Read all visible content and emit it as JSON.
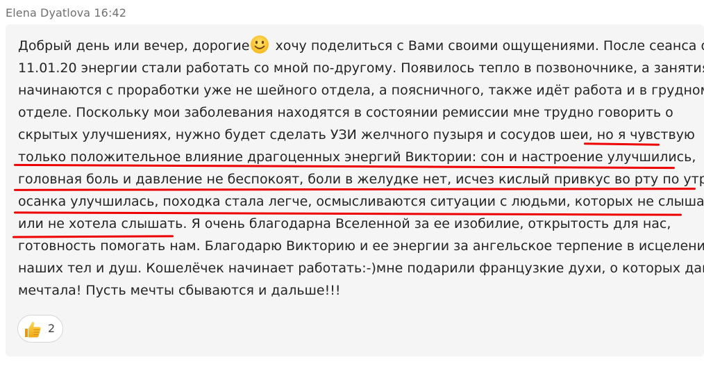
{
  "message": {
    "author": "Elena Dyatlova",
    "time": "16:42",
    "lines": [
      {
        "before": "Добрый день или вечер, дорогие",
        "after": " хочу поделиться с Вами своими ощущениями. После сеанса от"
      },
      {
        "text": "11.01.20 энергии стали работать со мной по-другому. Появилось тепло в позвоночнике, а занятия"
      },
      {
        "text": "начинаются с проработки уже не шейного отдела, а поясничного, также идёт работа и в грудном"
      },
      {
        "text": "отделе. Поскольку мои заболевания находятся в состоянии ремиссии мне трудно говорить о"
      },
      {
        "text": "скрытых улучшениях, нужно будет сделать УЗИ желчного пузыря и сосудов шеи, но я чувствую"
      },
      {
        "text": "только положительное влияние драгоценных энергий Виктории: сон и настроение улучшились,"
      },
      {
        "text": "головная боль и давление не беспокоят, боли в желудке нет, исчез кислый привкус во рту по утрам,"
      },
      {
        "text": "осанка улучшилась, походка стала легче, осмысливаются ситуации с людьми, которых не слышала"
      },
      {
        "text": "или не хотела слышать. Я очень благодарна Вселенной за ее изобилие, открытость для нас,"
      },
      {
        "text": "готовность помогать нам. Благодарю Викторию и ее энергии за ангельское терпение в исцелении"
      },
      {
        "text": "наших тел и душ. Кошелёчек начинает работать:-)мне подарили французкие духи, о которых давно"
      },
      {
        "text": "мечтала! Пусть мечты сбываются и дальше!!!"
      }
    ],
    "emoji_icon": "smiling-face-emoji",
    "underline_color": "#ee0000"
  },
  "reaction": {
    "icon": "thumbs-up-icon",
    "count": "2"
  }
}
